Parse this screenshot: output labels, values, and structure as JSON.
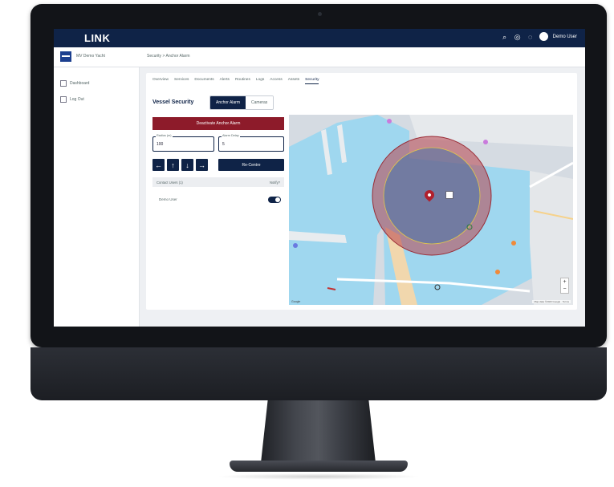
{
  "app": {
    "brand": "LINK",
    "user_name": "Demo User",
    "vessel_name": "MV Demo Yacht",
    "breadcrumb": "Security > Anchor Alarm"
  },
  "sidebar": {
    "items": [
      {
        "label": "Dashboard",
        "icon": "grid-icon"
      },
      {
        "label": "Log Out",
        "icon": "logout-icon"
      }
    ]
  },
  "tabs": [
    {
      "label": "Overview",
      "active": false
    },
    {
      "label": "Services",
      "active": false
    },
    {
      "label": "Documents",
      "active": false
    },
    {
      "label": "Alerts",
      "active": false
    },
    {
      "label": "Routines",
      "active": false
    },
    {
      "label": "Logs",
      "active": false
    },
    {
      "label": "Access",
      "active": false
    },
    {
      "label": "Assets",
      "active": false
    },
    {
      "label": "Security",
      "active": true
    }
  ],
  "security": {
    "title": "Vessel Security",
    "segment": {
      "anchor_label": "Anchor Alarm",
      "cameras_label": "Cameras"
    },
    "deactivate_label": "Deactivate Anchor Alarm",
    "radius": {
      "label": "Radius (m)",
      "value": "100"
    },
    "delay": {
      "label": "Alarm Delay",
      "value": "5"
    },
    "arrows": [
      "←",
      "↑",
      "↓",
      "→"
    ],
    "recenter_label": "Re-Centre",
    "table": {
      "col_contact": "Contact Users (1)",
      "col_notify": "Notify?"
    },
    "contacts": [
      {
        "name": "Demo User",
        "notify": true
      }
    ]
  },
  "map": {
    "zoom_in": "+",
    "zoom_out": "−",
    "google_label": "Google",
    "attribution": "Map data ©2023 Google · Terms",
    "marina_label": "P & O Marina",
    "colors": {
      "water": "#9fd7ef",
      "alarm_fill": "#b8424b",
      "alarm_inner": "#2a6fb0",
      "pin": "#b11f2c"
    }
  },
  "colors": {
    "navy": "#0f2347",
    "danger": "#8d1b2a"
  }
}
